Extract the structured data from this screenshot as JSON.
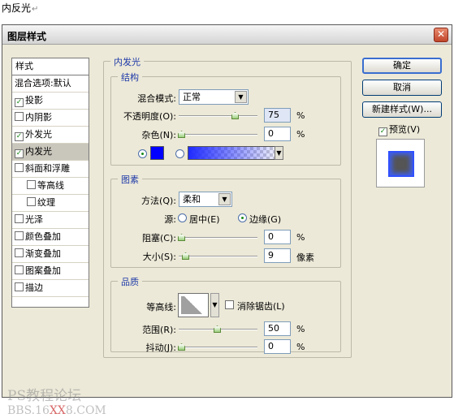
{
  "doc_header": {
    "text": "内反光",
    "para_mark": "↵"
  },
  "dialog": {
    "title": "图层样式",
    "close": "✕"
  },
  "styles_list": {
    "header": "样式",
    "blend_options": "混合选项:默认",
    "items": [
      {
        "label": "投影",
        "checked": true
      },
      {
        "label": "内阴影",
        "checked": false
      },
      {
        "label": "外发光",
        "checked": true
      },
      {
        "label": "内发光",
        "checked": true,
        "selected": true
      },
      {
        "label": "斜面和浮雕",
        "checked": false
      },
      {
        "label": "等高线",
        "checked": false,
        "sub": true
      },
      {
        "label": "纹理",
        "checked": false,
        "sub": true
      },
      {
        "label": "光泽",
        "checked": false
      },
      {
        "label": "颜色叠加",
        "checked": false
      },
      {
        "label": "渐变叠加",
        "checked": false
      },
      {
        "label": "图案叠加",
        "checked": false
      },
      {
        "label": "描边",
        "checked": false
      }
    ]
  },
  "inner_glow": {
    "legend": "内发光",
    "structure": {
      "legend": "结构",
      "blend_mode_label": "混合模式:",
      "blend_mode_value": "正常",
      "opacity_label": "不透明度(O):",
      "opacity_value": "75",
      "opacity_unit": "%",
      "opacity_level": 0.75,
      "noise_label": "杂色(N):",
      "noise_value": "0",
      "noise_unit": "%",
      "noise_level": 0,
      "glow_color": "#0000ff"
    },
    "elements": {
      "legend": "图素",
      "technique_label": "方法(Q):",
      "technique_value": "柔和",
      "source_label": "源:",
      "source_center": "居中(E)",
      "source_edge": "边缘(G)",
      "choke_label": "阻塞(C):",
      "choke_value": "0",
      "choke_unit": "%",
      "size_label": "大小(S):",
      "size_value": "9",
      "size_unit": "像素"
    },
    "quality": {
      "legend": "品质",
      "contour_label": "等高线:",
      "antialias_label": "消除锯齿(L)",
      "range_label": "范围(R):",
      "range_value": "50",
      "range_unit": "%",
      "range_level": 0.5,
      "jitter_label": "抖动(J):",
      "jitter_value": "0",
      "jitter_unit": "%"
    }
  },
  "buttons": {
    "ok": "确定",
    "cancel": "取消",
    "new_style": "新建样式(W)...",
    "preview": "预览(V)"
  },
  "watermark": {
    "line1": "PS教程论坛",
    "line2_pre": "BBS.16",
    "line2_red": "XX",
    "line2_post": "8.COM"
  }
}
